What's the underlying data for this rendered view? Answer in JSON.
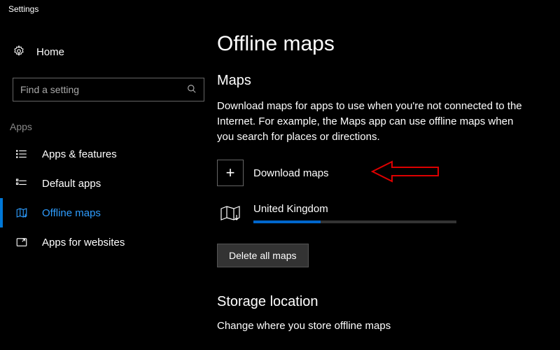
{
  "window": {
    "title": "Settings"
  },
  "sidebar": {
    "home_label": "Home",
    "search_placeholder": "Find a setting",
    "section_label": "Apps",
    "items": [
      {
        "label": "Apps & features"
      },
      {
        "label": "Default apps"
      },
      {
        "label": "Offline maps"
      },
      {
        "label": "Apps for websites"
      }
    ]
  },
  "main": {
    "title": "Offline maps",
    "maps_heading": "Maps",
    "description": "Download maps for apps to use when you're not connected to the Internet. For example, the Maps app can use offline maps when you search for places or directions.",
    "download_label": "Download maps",
    "map_entry": {
      "name": "United Kingdom",
      "progress_percent": 33
    },
    "delete_label": "Delete all maps",
    "storage_heading": "Storage location",
    "storage_desc": "Change where you store offline maps"
  }
}
